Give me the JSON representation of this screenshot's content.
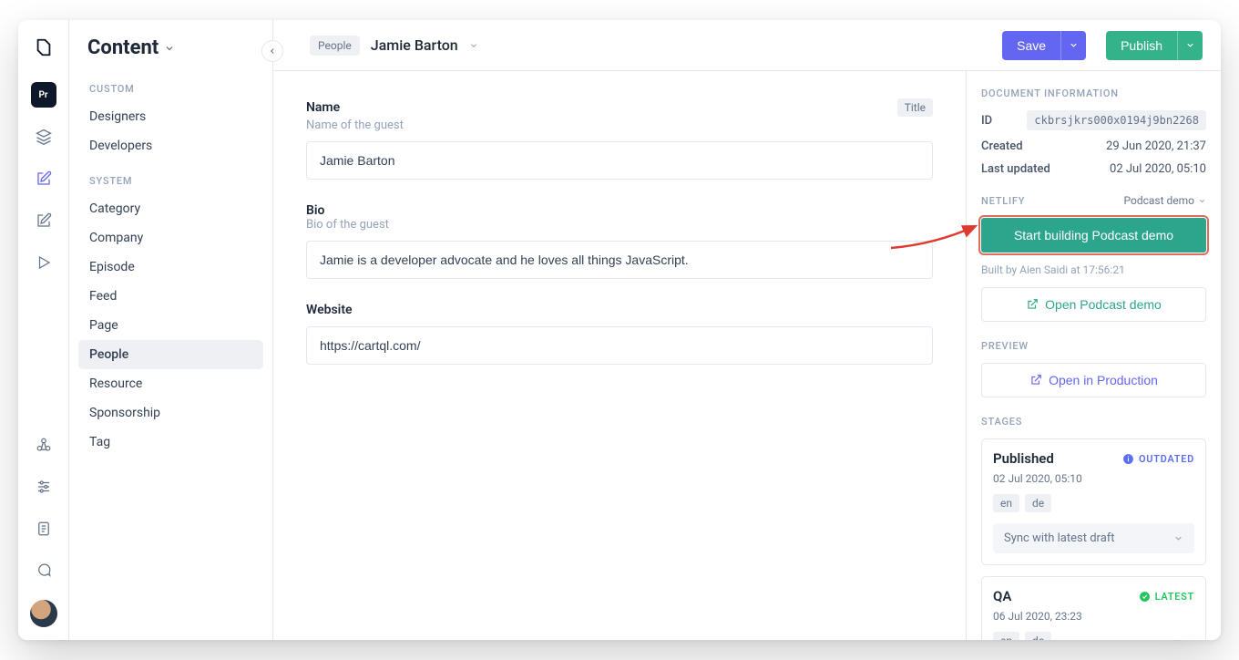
{
  "rail": {
    "active_badge": "Pr"
  },
  "sidebar": {
    "title": "Content",
    "sections": {
      "custom": {
        "label": "CUSTOM",
        "items": [
          "Designers",
          "Developers"
        ]
      },
      "system": {
        "label": "SYSTEM",
        "items": [
          "Category",
          "Company",
          "Episode",
          "Feed",
          "Page",
          "People",
          "Resource",
          "Sponsorship",
          "Tag"
        ]
      }
    },
    "active_item": "People"
  },
  "topbar": {
    "breadcrumb_model": "People",
    "document_title": "Jamie Barton",
    "save_label": "Save",
    "publish_label": "Publish"
  },
  "form": {
    "name": {
      "label": "Name",
      "hint": "Name of the guest",
      "tag": "Title",
      "value": "Jamie Barton"
    },
    "bio": {
      "label": "Bio",
      "hint": "Bio of the guest",
      "value": "Jamie is a developer advocate and he loves all things JavaScript."
    },
    "website": {
      "label": "Website",
      "value": "https://cartql.com/"
    }
  },
  "panel": {
    "doc_info_label": "DOCUMENT INFORMATION",
    "id_label": "ID",
    "id_value": "ckbrsjkrs000x0194j9bn2268",
    "created_label": "Created",
    "created_value": "29 Jun 2020, 21:37",
    "updated_label": "Last updated",
    "updated_value": "02 Jul 2020, 05:10",
    "netlify_label": "NETLIFY",
    "netlify_project": "Podcast demo",
    "netlify_build_btn": "Start building Podcast demo",
    "netlify_built_by": "Built by Aien Saidi at 17:56:21",
    "netlify_open_btn": "Open Podcast demo",
    "preview_label": "PREVIEW",
    "preview_btn": "Open in Production",
    "stages_label": "STAGES",
    "stages": [
      {
        "name": "Published",
        "status": "OUTDATED",
        "date": "02 Jul 2020, 05:10",
        "langs": [
          "en",
          "de"
        ],
        "sync_label": "Sync with latest draft"
      },
      {
        "name": "QA",
        "status": "LATEST",
        "date": "06 Jul 2020, 23:23",
        "langs": [
          "en",
          "de"
        ]
      }
    ]
  }
}
